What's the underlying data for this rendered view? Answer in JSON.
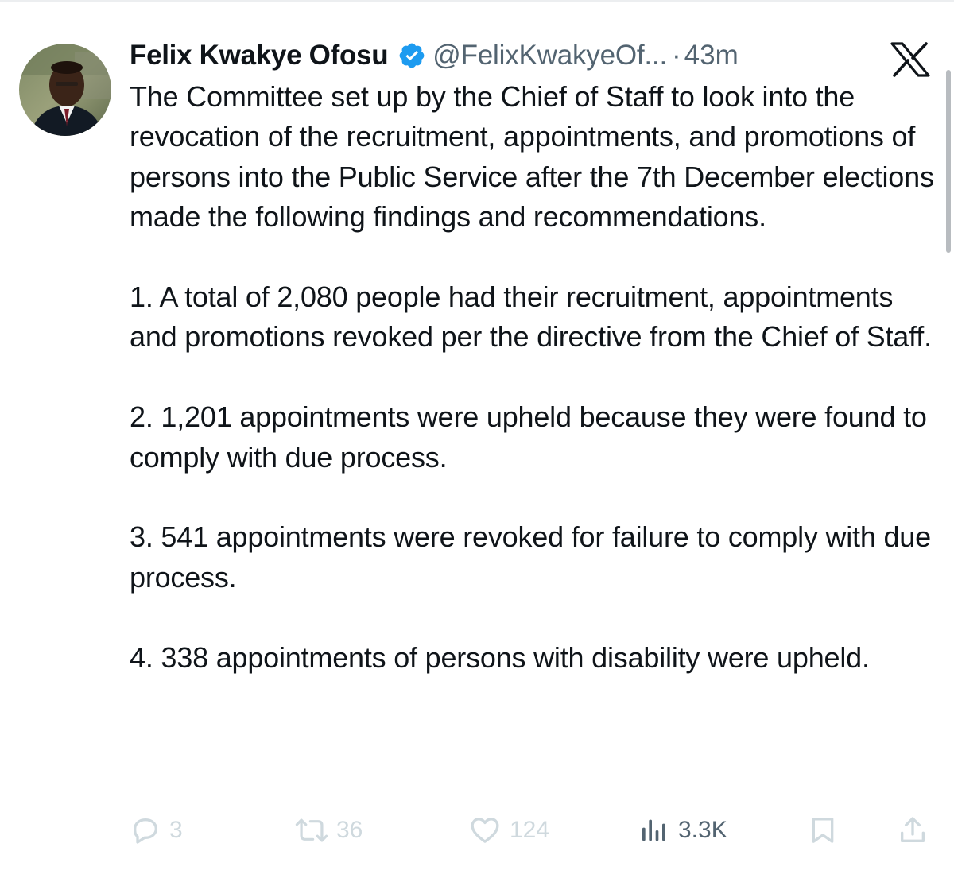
{
  "tweet": {
    "author_name": "Felix Kwakye Ofosu",
    "handle": "@FelixKwakyeOf...",
    "separator": "·",
    "time": "43m",
    "verified_icon": "verified-badge-icon",
    "paragraphs": [
      "The Committee set up by the Chief of Staff to look into the revocation of the recruitment, appointments, and promotions of persons into the Public  Service after the 7th December elections made the following findings and recommendations.",
      "1. A total of 2,080 people had their recruitment, appointments and promotions revoked per the directive from the Chief of Staff.",
      "2. 1,201 appointments were upheld because they were found to comply with due process.",
      "3. 541 appointments were revoked for failure to comply with due process.",
      "4. 338 appointments of persons with disability were upheld."
    ]
  },
  "actions": {
    "reply_count": "3",
    "retweet_count": "36",
    "like_count": "124",
    "views_count": "3.3K"
  },
  "icons": {
    "brand": "x-logo-icon",
    "reply": "reply-icon",
    "retweet": "retweet-icon",
    "like": "heart-icon",
    "views": "views-icon",
    "bookmark": "bookmark-icon",
    "share": "share-icon"
  },
  "colors": {
    "text": "#0f1419",
    "secondary": "#536471",
    "faded_action": "#cfd9de",
    "verified_blue": "#1d9bf0"
  }
}
